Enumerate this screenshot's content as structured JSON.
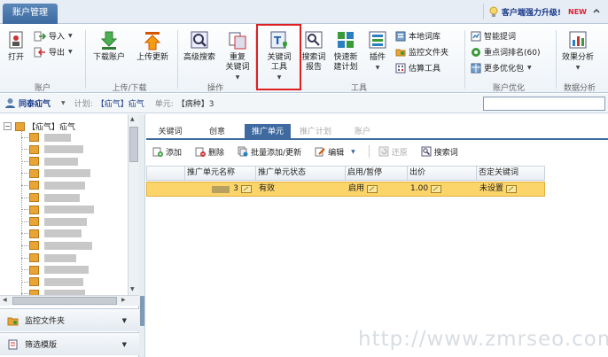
{
  "titlebar": {
    "tab": "账户管理",
    "upgrade": "客户端强力升级!",
    "badge": "NEW"
  },
  "ribbon": {
    "account": {
      "open": "打开",
      "import": "导入",
      "export": "导出",
      "group": "账户"
    },
    "updown": {
      "download": "下载账户",
      "upload": "上传更新",
      "group": "上传/下载"
    },
    "operate": {
      "advanced_search": "高级搜索",
      "duplicate_l1": "重复",
      "duplicate_l2": "关键词",
      "group": "操作"
    },
    "tools": {
      "keyword_tool_l1": "关键词",
      "keyword_tool_l2": "工具",
      "search_report_l1": "搜索词",
      "search_report_l2": "报告",
      "quick_plan_l1": "快速新",
      "quick_plan_l2": "建计划",
      "plugin": "插件",
      "local_lexicon": "本地词库",
      "monitor_folder": "监控文件夹",
      "estimate_tool": "估算工具",
      "group": "工具"
    },
    "optimize": {
      "smart_bid": "智能提词",
      "rank": "重点词排名(60)",
      "more_packages": "更多优化包",
      "group": "账户优化"
    },
    "analysis": {
      "effect_analysis": "效果分析",
      "group": "数据分析"
    }
  },
  "breadcrumb": {
    "account": "同泰疝气",
    "plan_label": "计划:",
    "plan_value": "【疝气】疝气",
    "unit_label": "单元:",
    "unit_value": "【病种】3"
  },
  "tree": {
    "root": "【疝气】疝气",
    "item_count": 14
  },
  "left_panel": {
    "monitor_folder": "监控文件夹",
    "filter_template": "筛选模版"
  },
  "tabs": [
    "关键词",
    "创意",
    "推广单元",
    "推广计划",
    "账户"
  ],
  "toolbar": {
    "add": "添加",
    "delete": "删除",
    "batch_add": "批量添加/更新",
    "edit": "编辑",
    "restore": "还原",
    "search_word": "搜索词"
  },
  "grid": {
    "columns": [
      "推广单元名称",
      "推广单元状态",
      "启用/暂停",
      "出价",
      "否定关键词"
    ],
    "rows": [
      {
        "name": "3",
        "status": "有效",
        "enabled": "启用",
        "bid": "1.00",
        "negative": "未设置"
      }
    ]
  },
  "watermark": "http://www.zmrseo.com",
  "colors": {
    "accent": "#3f6aa0",
    "highlight_row": "#fbd46a",
    "red_box": "#e02020",
    "link": "#1a3a8a"
  }
}
